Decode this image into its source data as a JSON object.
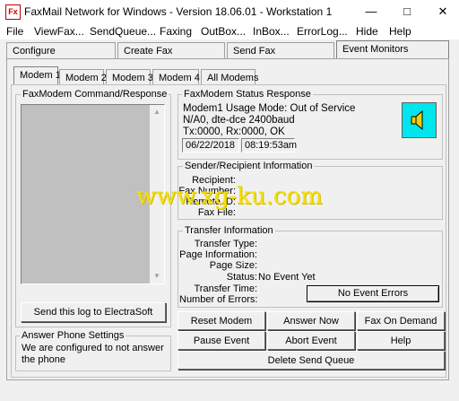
{
  "window": {
    "title": "FaxMail Network for Windows - Version 18.06.01 - Workstation 1",
    "icon_text": "Fx"
  },
  "menu": [
    "File",
    "ViewFax...",
    "SendQueue...",
    "Faxing",
    "OutBox...",
    "InBox...",
    "ErrorLog...",
    "Hide",
    "Help"
  ],
  "main_tabs": [
    "Configure",
    "Create Fax",
    "Send Fax",
    "Event Monitors"
  ],
  "modem_tabs": [
    "Modem 1",
    "Modem 2",
    "Modem 3",
    "Modem 4",
    "All Modems"
  ],
  "command_response": {
    "label": "FaxModem Command/Response",
    "send_log_button": "Send this log to ElectraSoft"
  },
  "answer_phone": {
    "label": "Answer Phone Settings",
    "text": "We are configured to not answer the phone"
  },
  "status": {
    "label": "FaxModem Status Response",
    "lines": [
      "Modem1 Usage Mode: Out of Service",
      "N/A0, dte-dce 2400baud",
      "Tx:0000, Rx:0000, OK"
    ],
    "date": "06/22/2018",
    "time": "08:19:53am",
    "icon": "speaker-icon"
  },
  "sender_recipient": {
    "label": "Sender/Recipient Information",
    "fields": [
      "Recipient:",
      "Fax Number:",
      "Remote ID:",
      "Fax File:"
    ]
  },
  "transfer": {
    "label": "Transfer Information",
    "fields": [
      "Transfer Type:",
      "Page Information:",
      "Page Size:",
      "Status:",
      "Transfer Time:",
      "Number of Errors:"
    ],
    "status_value": "No Event Yet",
    "errors_button": "No Event Errors"
  },
  "buttons": {
    "reset_modem": "Reset Modem",
    "answer_now": "Answer Now",
    "fax_on_demand": "Fax On Demand",
    "pause_event": "Pause Event",
    "abort_event": "Abort Event",
    "help": "Help",
    "delete_send_queue": "Delete Send Queue"
  },
  "watermark": "www.xg-ku.com",
  "colors": {
    "status_icon_bg": "#00e5ee",
    "watermark": "#f4e00a",
    "listbox_bg": "#c0c0c0"
  }
}
